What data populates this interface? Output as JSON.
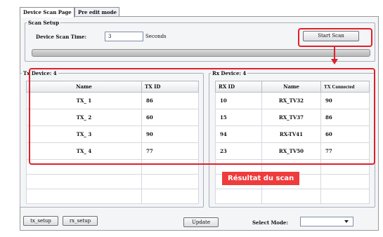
{
  "tabs": [
    {
      "label": "Device Scan Page",
      "active": true
    },
    {
      "label": "Pre edit mode",
      "active": false
    }
  ],
  "scan_setup": {
    "legend": "Scan Setup",
    "time_label": "Device Scan Time:",
    "time_value": "3",
    "unit": "Seconds",
    "start_label": "Start Scan"
  },
  "tx": {
    "legend": "Tx Device: 4",
    "headers": [
      "Name",
      "TX ID"
    ],
    "rows": [
      {
        "name": "TX_ 1",
        "id": "86"
      },
      {
        "name": "TX_ 2",
        "id": "60"
      },
      {
        "name": "TX_ 3",
        "id": "90"
      },
      {
        "name": "TX_ 4",
        "id": "77"
      }
    ]
  },
  "rx": {
    "legend": "Rx Device: 4",
    "headers": [
      "RX ID",
      "Name",
      "TX Connected"
    ],
    "rows": [
      {
        "id": "10",
        "name": "RX_TV32",
        "tx": "90"
      },
      {
        "id": "15",
        "name": "RX_TV37",
        "tx": "86"
      },
      {
        "id": "94",
        "name": "RX-TV41",
        "tx": "60"
      },
      {
        "id": "23",
        "name": "RX_TV50",
        "tx": "77"
      }
    ]
  },
  "bottom": {
    "tx_setup": "tx_setup",
    "rx_setup": "rx_setup",
    "update": "Update",
    "select_mode_label": "Select Mode:",
    "select_mode_value": ""
  },
  "annotation": {
    "label": "Résultat du scan",
    "color": "#e0202a"
  }
}
